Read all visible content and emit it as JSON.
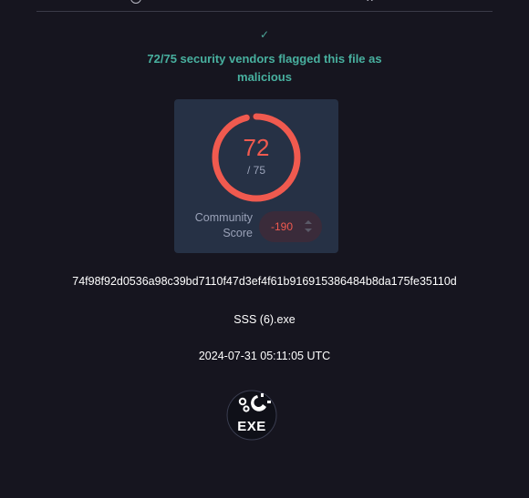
{
  "top_bar": {
    "left_icon": "info-circle-icon",
    "right_icon": "network-graph-icon"
  },
  "verdict": {
    "icon": "check-icon",
    "check_glyph": "✓",
    "text": "72/75 security vendors flagged this file as malicious",
    "color": "#48b09f"
  },
  "detection": {
    "detected": "72",
    "total_label": "/ 75",
    "ratio": 0.96,
    "ring_color": "#f05a4f"
  },
  "community_score": {
    "label": "Community Score",
    "value": "-190"
  },
  "file": {
    "hash": "74f98f92d0536a98c39bd7110f47d3ef4f61b916915386484b8da175fe35110d",
    "name": "SSS (6).exe",
    "timestamp": "2024-07-31 05:11:05 UTC",
    "type_label": "EXE",
    "type_icon": "exe-file-type-icon"
  }
}
